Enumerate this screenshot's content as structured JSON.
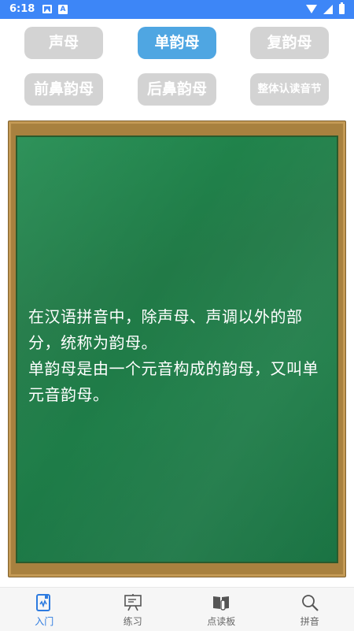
{
  "status_bar": {
    "time": "6:18",
    "notification_glyph": "A"
  },
  "categories": [
    {
      "label": "声母",
      "active": false
    },
    {
      "label": "单韵母",
      "active": true
    },
    {
      "label": "复韵母",
      "active": false
    },
    {
      "label": "前鼻韵母",
      "active": false
    },
    {
      "label": "后鼻韵母",
      "active": false
    },
    {
      "label": "整体认读音节",
      "active": false
    }
  ],
  "board": {
    "paragraphs": [
      "在汉语拼音中，除声母、声调以外的部分，统称为韵母。",
      "单韵母是由一个元音构成的韵母，又叫单元音韵母。"
    ]
  },
  "bottom_nav": [
    {
      "label": "入门",
      "icon": "book-audio-icon",
      "active": true
    },
    {
      "label": "练习",
      "icon": "presentation-board-icon",
      "active": false
    },
    {
      "label": "点读板",
      "icon": "reading-pen-icon",
      "active": false
    },
    {
      "label": "拼音",
      "icon": "magnifier-icon",
      "active": false
    }
  ],
  "colors": {
    "status_bar": "#3d86f7",
    "active_button": "#4fa6e2",
    "inactive_button": "#d3d3d3",
    "board_green": "#1f8a4e",
    "frame_wood": "#a8813f",
    "nav_active": "#2d7be0"
  }
}
